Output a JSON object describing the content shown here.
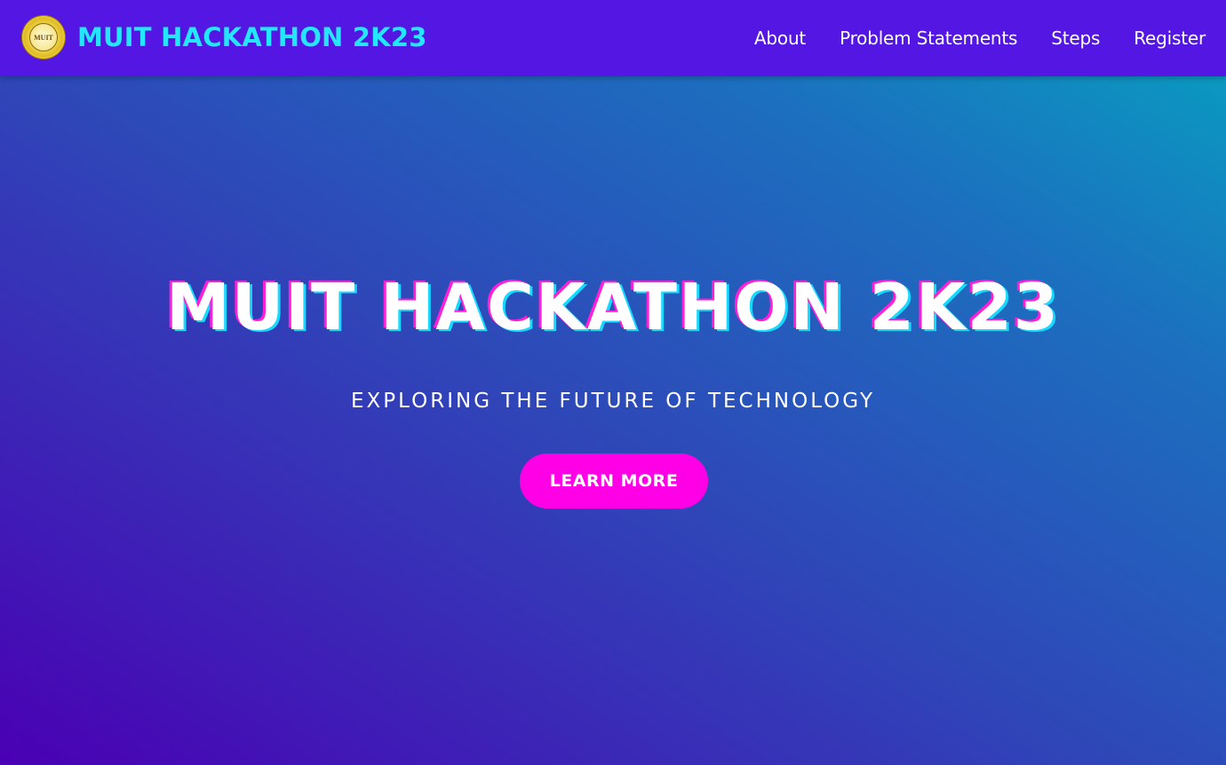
{
  "navbar": {
    "brand": {
      "logo_text": "MUIT",
      "title": "MUIT HACKATHON 2K23"
    },
    "links": [
      {
        "label": "About"
      },
      {
        "label": "Problem Statements"
      },
      {
        "label": "Steps"
      },
      {
        "label": "Register"
      }
    ],
    "colors": {
      "background": "#5316e3",
      "brand_title": "#24e6ff",
      "link": "#ffffff"
    }
  },
  "hero": {
    "title": "MUIT HACKATHON 2K23",
    "subtitle": "EXPLORING THE FUTURE OF TECHNOLOGY",
    "cta_label": "LEARN MORE",
    "colors": {
      "gradient_start": "#4a00b4",
      "gradient_end": "#06a3c0",
      "title_shadow_magenta": "#ff1fd7",
      "title_shadow_cyan": "#16d9ff",
      "cta_background": "#ff00e6"
    }
  }
}
